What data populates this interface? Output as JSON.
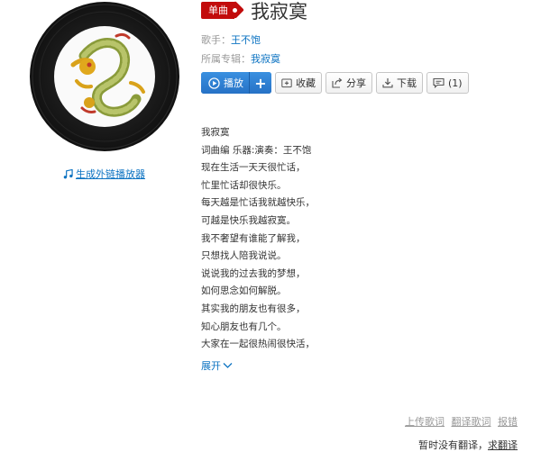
{
  "header": {
    "badge": "单曲",
    "title": "我寂寞",
    "singer_label": "歌手：",
    "singer": "王不饱",
    "album_label": "所属专辑：",
    "album": "我寂寞"
  },
  "actions": {
    "play": "播放",
    "add": "+",
    "favorite": "收藏",
    "share": "分享",
    "download": "下载",
    "comment": "(1)"
  },
  "left": {
    "external_player_link": "生成外链播放器"
  },
  "lyrics": [
    "我寂寞",
    "词曲编 乐器:演奏：王不饱",
    "现在生活一天天很忙话，",
    "忙里忙话却很快乐。",
    "每天越是忙话我就越快乐，",
    "可越是快乐我越寂寞。",
    "我不奢望有谁能了解我，",
    "只想找人陪我说说。",
    "说说我的过去我的梦想，",
    "如何思念如何解脱。",
    "其实我的朋友也有很多，",
    "知心朋友也有几个。",
    "大家在一起很热闹很快活，"
  ],
  "expand_label": "展开",
  "footer": {
    "upload": "上传歌词",
    "translate": "翻译歌词",
    "report": "报错",
    "no_translation": "暂时没有翻译，",
    "request": "求翻译"
  },
  "colors": {
    "accent_red": "#c20c0c",
    "link_blue": "#0c73c2",
    "play_blue": "#2a7fd3"
  }
}
